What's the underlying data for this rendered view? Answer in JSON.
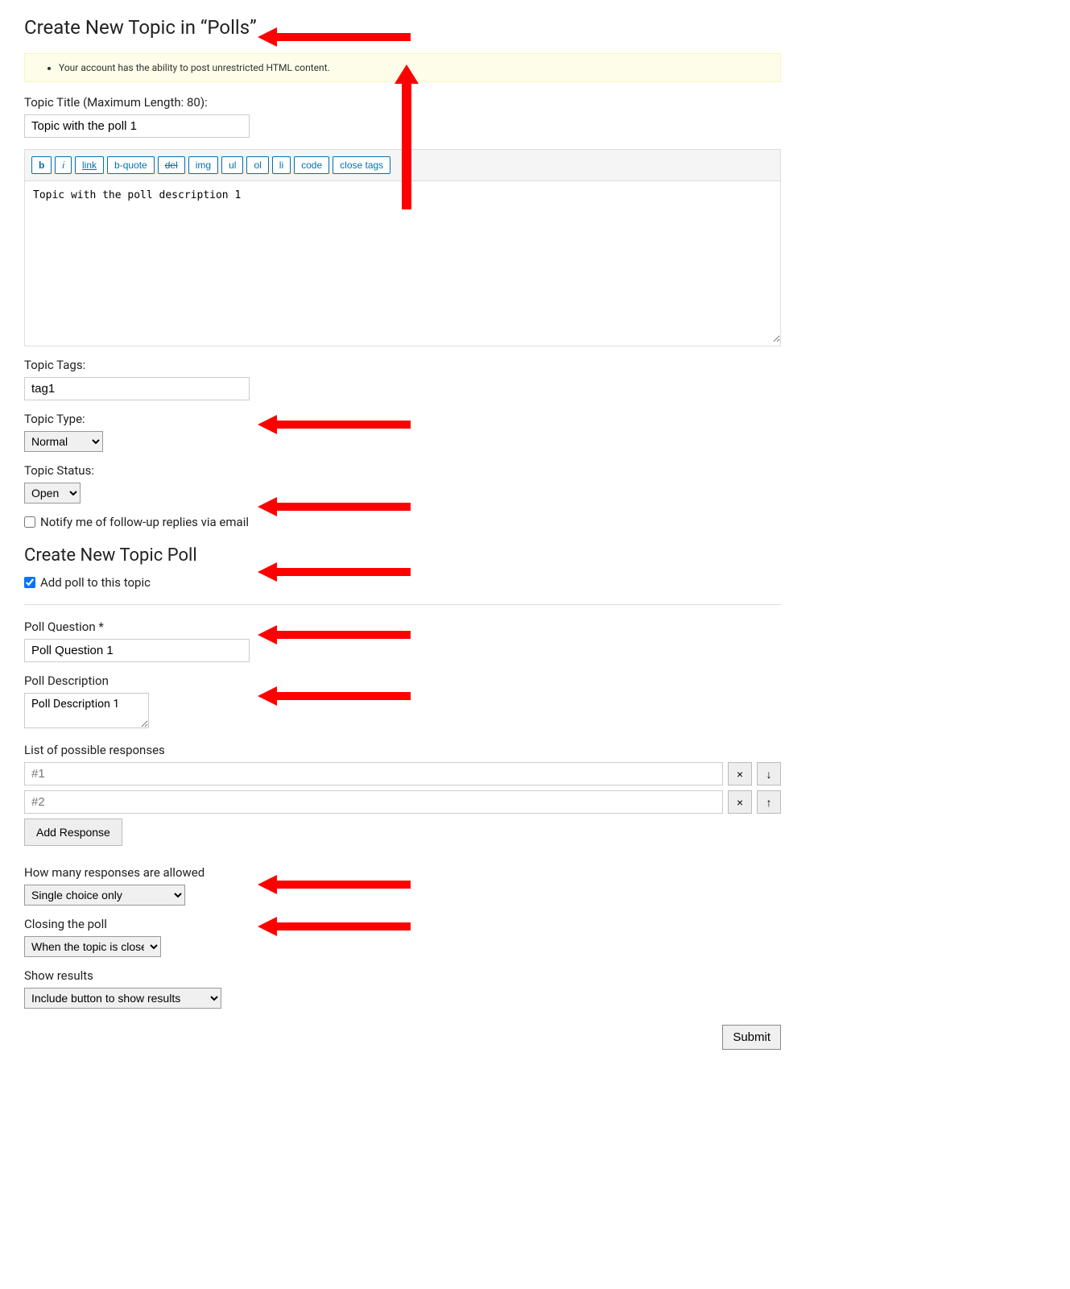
{
  "header": {
    "title": "Create New Topic in “Polls”"
  },
  "notice": {
    "text": "Your account has the ability to post unrestricted HTML content."
  },
  "title_field": {
    "label": "Topic Title (Maximum Length: 80):",
    "value": "Topic with the poll 1"
  },
  "editor": {
    "buttons": {
      "b": "b",
      "i": "i",
      "link": "link",
      "bquote": "b-quote",
      "del": "del",
      "img": "img",
      "ul": "ul",
      "ol": "ol",
      "li": "li",
      "code": "code",
      "close": "close tags"
    },
    "content": "Topic with the poll description 1"
  },
  "tags": {
    "label": "Topic Tags:",
    "value": "tag1"
  },
  "topic_type": {
    "label": "Topic Type:",
    "value": "Normal"
  },
  "topic_status": {
    "label": "Topic Status:",
    "value": "Open"
  },
  "notify": {
    "label": "Notify me of follow-up replies via email",
    "checked": false
  },
  "poll_section": {
    "heading": "Create New Topic Poll",
    "add_poll_label": "Add poll to this topic",
    "add_poll_checked": true
  },
  "poll_question": {
    "label": "Poll Question *",
    "value": "Poll Question 1"
  },
  "poll_description": {
    "label": "Poll Description",
    "value": "Poll Description 1"
  },
  "responses": {
    "label": "List of possible responses",
    "items": [
      {
        "placeholder": "#1"
      },
      {
        "placeholder": "#2"
      }
    ],
    "add_label": "Add Response"
  },
  "allowed": {
    "label": "How many responses are allowed",
    "value": "Single choice only"
  },
  "closing": {
    "label": "Closing the poll",
    "value": "When the topic is closed"
  },
  "show_results": {
    "label": "Show results",
    "value": "Include button to show results"
  },
  "submit": {
    "label": "Submit"
  },
  "icons": {
    "remove": "×",
    "down": "↓",
    "up": "↑"
  }
}
